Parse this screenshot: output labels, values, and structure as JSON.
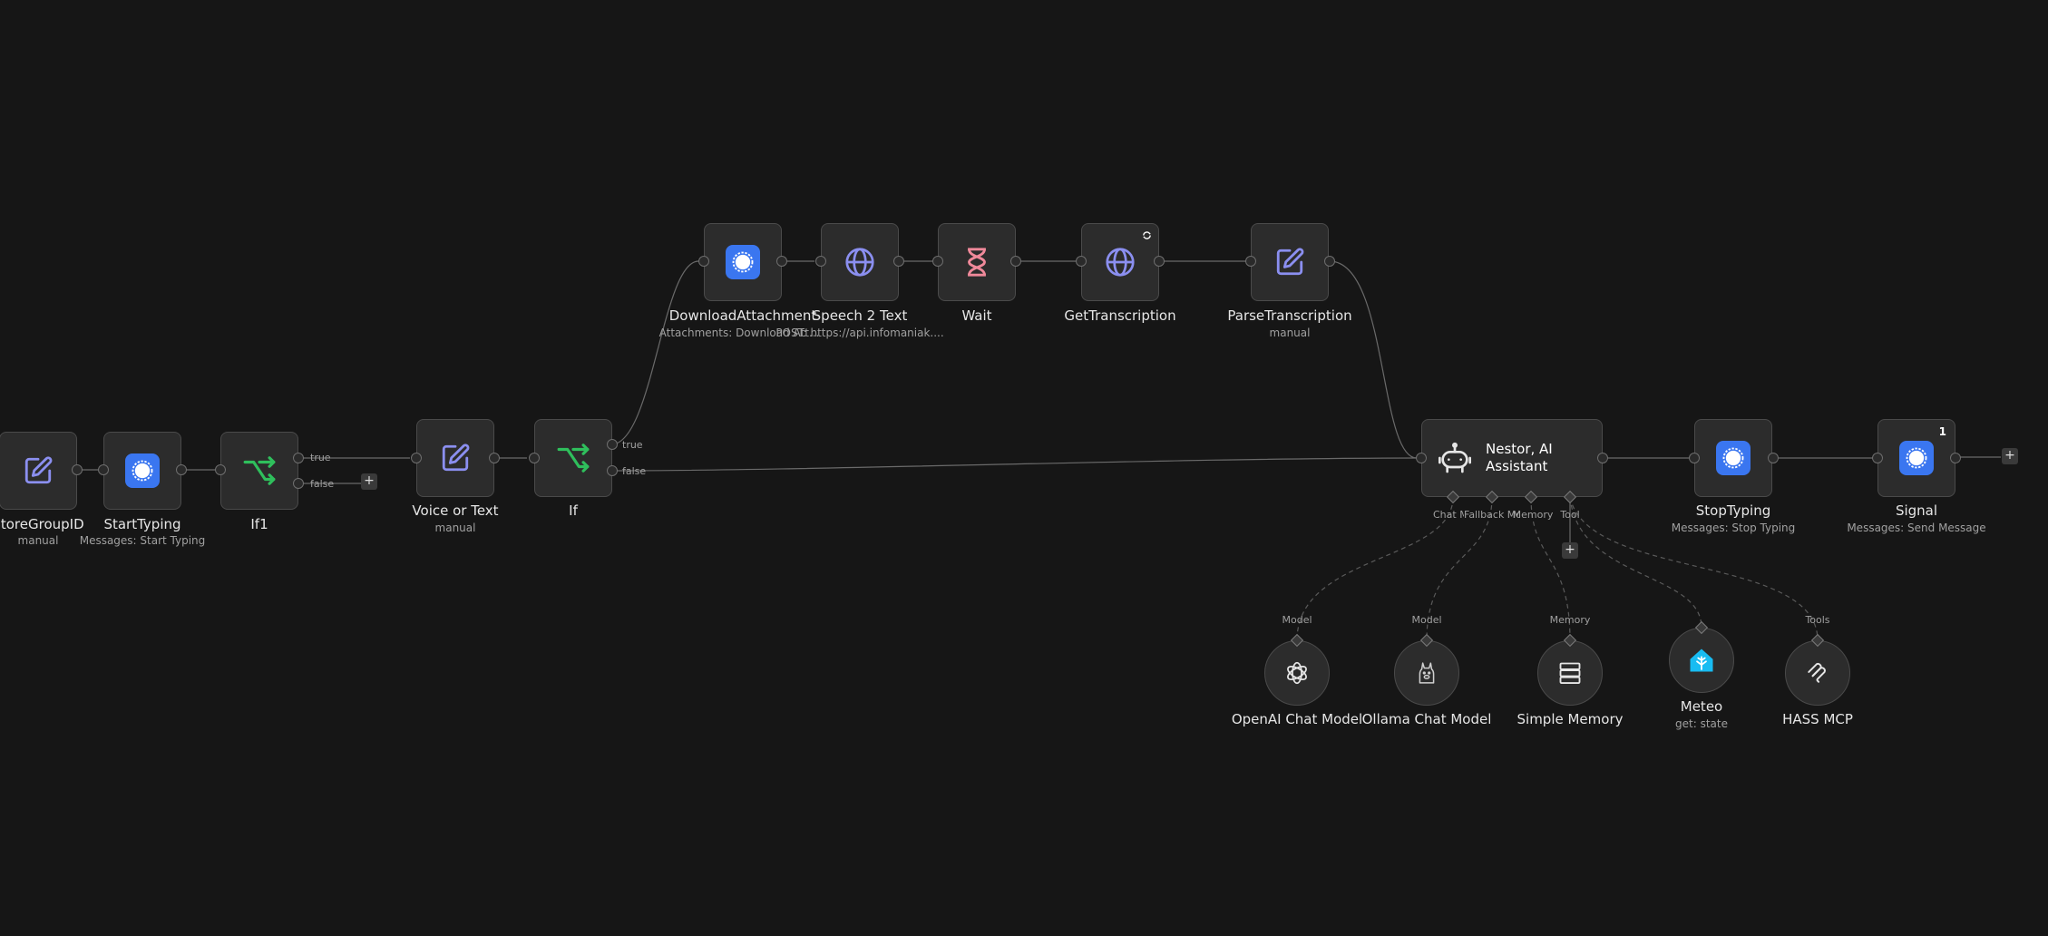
{
  "nodes": [
    {
      "id": "storegroupid",
      "label": "StoreGroupID",
      "sub": "manual",
      "icon": "pencil-icon"
    },
    {
      "id": "starttyping",
      "label": "StartTyping",
      "sub": "Messages: Start Typing",
      "icon": "signal-icon"
    },
    {
      "id": "if1",
      "label": "If1",
      "sub": "",
      "icon": "branch-icon"
    },
    {
      "id": "voice",
      "label": "Voice or Text",
      "sub": "manual",
      "icon": "pencil-icon"
    },
    {
      "id": "if",
      "label": "If",
      "sub": "",
      "icon": "branch-icon"
    },
    {
      "id": "download",
      "label": "DownloadAttachment",
      "sub": "Attachments: Download Att...",
      "icon": "signal-icon"
    },
    {
      "id": "speech",
      "label": "Speech 2 Text",
      "sub": "POST: https://api.infomaniak....",
      "icon": "globe-icon"
    },
    {
      "id": "wait",
      "label": "Wait",
      "sub": "",
      "icon": "hourglass-icon"
    },
    {
      "id": "gettrans",
      "label": "GetTranscription",
      "sub": "",
      "icon": "globe-icon"
    },
    {
      "id": "parsetrans",
      "label": "ParseTranscription",
      "sub": "manual",
      "icon": "pencil-icon"
    },
    {
      "id": "stoptyping",
      "label": "StopTyping",
      "sub": "Messages: Stop Typing",
      "icon": "signal-icon"
    },
    {
      "id": "signal",
      "label": "Signal",
      "sub": "Messages: Send Message",
      "icon": "signal-icon"
    }
  ],
  "agent": {
    "name": "Nestor, AI Assistant",
    "icon": "robot-icon",
    "handles": [
      "Chat Model",
      "Fallback Model",
      "Memory",
      "Tool"
    ]
  },
  "subnodes": [
    {
      "id": "openai",
      "label": "OpenAI Chat Model",
      "sub": "",
      "handle": "Model",
      "icon": "openai-icon"
    },
    {
      "id": "ollama",
      "label": "Ollama Chat Model",
      "sub": "",
      "handle": "Model",
      "icon": "ollama-icon"
    },
    {
      "id": "memory",
      "label": "Simple Memory",
      "sub": "",
      "handle": "Memory",
      "icon": "database-icon"
    },
    {
      "id": "meteo",
      "label": "Meteo",
      "sub": "get: state",
      "handle": "",
      "icon": "home-assistant-icon"
    },
    {
      "id": "hass",
      "label": "HASS MCP",
      "sub": "",
      "handle": "Tools",
      "icon": "mcp-icon"
    }
  ],
  "branches": {
    "true": "true",
    "false": "false"
  },
  "badges": {
    "signal": "1"
  },
  "add_label": "+",
  "colors": {
    "canvas": "#161616",
    "node": "#2c2c2c",
    "node_border": "#4a4a4a",
    "accent_purple": "#8b8ff0",
    "accent_green": "#2fbf5c",
    "accent_pink": "#f0899a",
    "signal_blue": "#3a76f0",
    "ha_blue": "#18bcf2"
  }
}
